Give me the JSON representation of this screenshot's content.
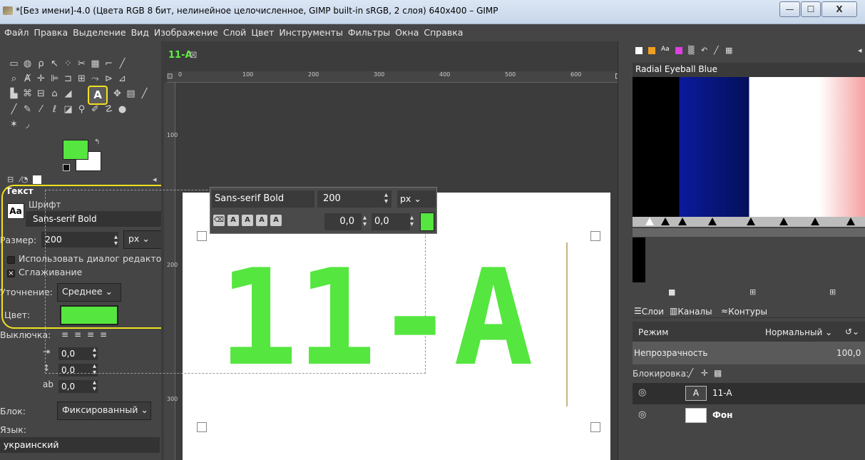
{
  "window": {
    "title": "*[Без имени]-4.0 (Цвета RGB 8 бит, нелинейное целочисленное, GIMP built-in sRGB, 2 слоя) 640x400 – GIMP",
    "minimize": "—",
    "maximize": "☐",
    "close": "X"
  },
  "menu": [
    "Файл",
    "Правка",
    "Выделение",
    "Вид",
    "Изображение",
    "Слой",
    "Цвет",
    "Инструменты",
    "Фильтры",
    "Окна",
    "Справка"
  ],
  "colors": {
    "foreground": "#55e63f",
    "background": "#ffffff",
    "highlight": "#f2e01f"
  },
  "toolbox": {
    "text_tool_glyph": "A"
  },
  "tool_options": {
    "title": "Текст",
    "font_label": "Шрифт",
    "font_icon": "Aa",
    "font_value": "Sans-serif Bold",
    "size_label": "Размер:",
    "size_value": "200",
    "size_unit": "px",
    "use_editor_label": "Использовать диалог редактора",
    "antialias_label": "Сглаживание",
    "hinting_label": "Уточнение:",
    "hinting_value": "Среднее",
    "color_label": "Цвет:",
    "justify_label": "Выключка:",
    "indent_value": "0,0",
    "line_spacing_value": "0,0",
    "letter_spacing_value": "0,0",
    "box_label": "Блок:",
    "box_value": "Фиксированный",
    "language_label": "Язык:",
    "language_value": "украинский"
  },
  "image": {
    "tab_label": "11-A",
    "text_content": "11-A",
    "hruler_labels": [
      "0",
      "100",
      "200",
      "300",
      "400",
      "500",
      "600"
    ],
    "vruler_labels": [
      "100",
      "200",
      "300"
    ]
  },
  "style_editor": {
    "font": "Sans-serif Bold",
    "size": "200",
    "unit": "px",
    "baseline": "0,0",
    "kerning": "0,0"
  },
  "gradients": {
    "name": "Radial Eyeball Blue"
  },
  "layers_dock": {
    "tabs": [
      "Слои",
      "Каналы",
      "Контуры"
    ],
    "mode_label": "Режим",
    "mode_value": "Нормальный",
    "opacity_label": "Непрозрачность",
    "opacity_value": "100,0",
    "lock_label": "Блокировка:",
    "layers": [
      {
        "name": "11-A",
        "bold": false
      },
      {
        "name": "Фон",
        "bold": true
      }
    ]
  }
}
